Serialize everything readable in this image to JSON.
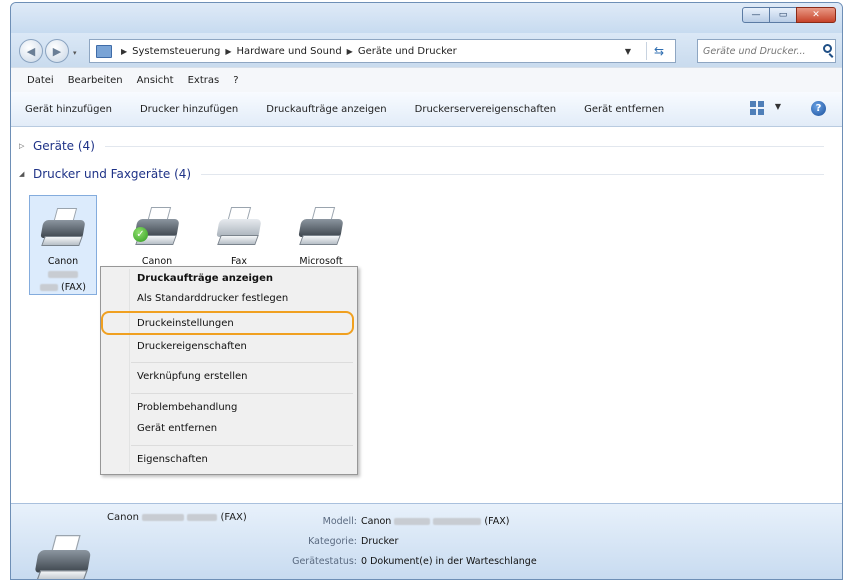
{
  "window": {
    "controls": {
      "minimize": "—",
      "maximize": "▭",
      "close": "✕"
    }
  },
  "navigation": {
    "back": "◀",
    "forward": "▶",
    "breadcrumb": [
      "Systemsteuerung",
      "Hardware und Sound",
      "Geräte und Drucker"
    ],
    "search_placeholder": "Geräte und Drucker... "
  },
  "menubar": {
    "items": [
      "Datei",
      "Bearbeiten",
      "Ansicht",
      "Extras",
      "?"
    ]
  },
  "toolbar": {
    "buttons": [
      "Gerät hinzufügen",
      "Drucker hinzufügen",
      "Druckaufträge anzeigen",
      "Druckerservereigenschaften",
      "Gerät entfernen"
    ]
  },
  "groups": {
    "devices": {
      "label": "Geräte (4)"
    },
    "printers": {
      "label": "Drucker und Faxgeräte (4)"
    }
  },
  "devices": [
    {
      "line1": "Canon",
      "line3": "(FAX)",
      "selected": true
    },
    {
      "line1": "Canon",
      "checked": true
    },
    {
      "line1": "Fax"
    },
    {
      "line1": "Microsoft"
    }
  ],
  "context_menu": {
    "items": [
      "Druckaufträge anzeigen",
      "Als Standarddrucker festlegen",
      "Druckeinstellungen",
      "Druckereigenschaften",
      "Verknüpfung erstellen",
      "Problembehandlung",
      "Gerät entfernen",
      "Eigenschaften"
    ],
    "highlighted": "Druckeinstellungen"
  },
  "details": {
    "name_prefix": "Canon",
    "name_suffix": "(FAX)",
    "model_label": "Modell:",
    "model_prefix": "Canon",
    "model_suffix": "(FAX)",
    "category_label": "Kategorie:",
    "category_value": "Drucker",
    "status_label": "Gerätestatus:",
    "status_value": "0 Dokument(e) in der Warteschlange"
  },
  "colors": {
    "accent_highlight": "#f0a020",
    "selection": "#dcebfc",
    "group_header": "#1e3287"
  }
}
